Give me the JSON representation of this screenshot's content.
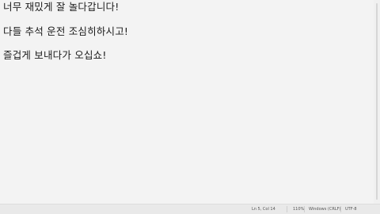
{
  "editor": {
    "lines": [
      "너무 재밌게 잘 놀다갑니다!",
      "다들 추석 운전 조심히하시고!",
      "즐겁게 보내다가 오십쇼!"
    ]
  },
  "statusbar": {
    "position": "Ln 5, Col 14",
    "zoom": "110%",
    "line_ending": "Windows (CRLF)",
    "encoding": "UTF-8"
  }
}
